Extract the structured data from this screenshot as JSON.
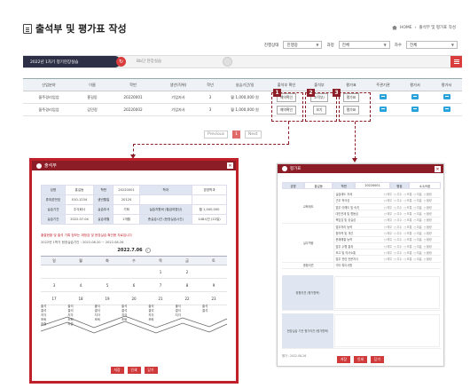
{
  "header": {
    "title": "출석부 및 평가표 작성",
    "breadcrumb": [
      "HOME",
      "출석부 및 평가표 작성"
    ]
  },
  "filters": [
    {
      "label": "진행상태",
      "value": "진행중"
    },
    {
      "label": "과정",
      "value": "전체"
    },
    {
      "label": "차수",
      "value": "전체"
    }
  ],
  "course_bar": {
    "course_name": "2022년 1차기 정기현장실습",
    "placeholder": "Bb단 현장실습"
  },
  "table": {
    "headers": [
      "산업분야",
      "이름",
      "학번",
      "생년(직위)",
      "학년",
      "실습기간/일",
      "출석부 확인",
      "출석부",
      "평가표",
      "주관기관",
      "평가서",
      "평가서"
    ],
    "rows": [
      [
        "울주경리업업",
        "홍길동",
        "20220001",
        "기업자사",
        "3",
        "월 1,000,000 원",
        "예약확인",
        "조작부/",
        "평가표",
        "",
        "",
        ""
      ],
      [
        "울주경리업업",
        "김민정",
        "20220002",
        "기업자사",
        "3",
        "월 1,000,000 원",
        "예약확인",
        "보기",
        "평가표",
        "",
        "",
        ""
      ]
    ]
  },
  "tags": [
    "1",
    "2",
    "3"
  ],
  "pager": {
    "prev": "Previous",
    "current": "1",
    "next": "Next"
  },
  "attendance_panel": {
    "title": "출석부",
    "info": [
      [
        "성명",
        "홍길동",
        "학번",
        "20220001",
        "학과",
        "경영학과"
      ],
      [
        "휴대폰번호",
        "010-1234",
        "생년월일",
        "20120",
        "",
        ""
      ],
      [
        "실습기관",
        "주식회사",
        "실습부서",
        "기획",
        "실습지원비 (월급여환산)",
        "월 1,000,000"
      ],
      [
        "실습기간",
        "2022.07.04",
        "실습개월",
        "1개월",
        "총실습시간 (현장실습시간)",
        "148시간 (22일)"
      ]
    ],
    "note_red": "출결현황 및 출석 기록 정보는 재정검 및 현장실습 확인용 자료입니다",
    "note_gray": "2022년 1학기 현장실습기간 : 2022.06.20 ~ 2022.08.26",
    "month": "2022.7.06",
    "weekdays": [
      "일",
      "월",
      "화",
      "수",
      "목",
      "금",
      "토"
    ],
    "weeks": [
      [
        "",
        "",
        "",
        "",
        "1",
        "2",
        ""
      ],
      [
        "3",
        "4",
        "5",
        "6",
        "7",
        "8",
        "9"
      ]
    ],
    "week3": [
      "17",
      "18",
      "19",
      "20",
      "21",
      "22",
      "23"
    ],
    "entries": [
      {
        "day": "17",
        "lines": [
          "출석",
          "결석",
          "지각",
          "조퇴",
          "외출"
        ]
      },
      {
        "day": "18",
        "lines": [
          "출석",
          "결석",
          "지각",
          "조퇴",
          "외출"
        ]
      },
      {
        "day": "19",
        "lines": [
          "출석",
          "결석",
          "지각",
          "조퇴"
        ]
      },
      {
        "day": "20",
        "lines": [
          "출석",
          "결석",
          "지각",
          "조퇴"
        ]
      },
      {
        "day": "21",
        "lines": [
          "출석",
          "결석",
          "지각",
          "조퇴"
        ]
      },
      {
        "day": "22",
        "lines": [
          "출석",
          "결석",
          "지각"
        ]
      },
      {
        "day": "23",
        "lines": [
          "출석",
          "결석"
        ]
      }
    ],
    "buttons": [
      "저장",
      "인쇄",
      "닫기"
    ]
  },
  "eval_panel": {
    "title": "평가표",
    "top": [
      "성명",
      "홍길동",
      "학번",
      "20220001",
      "평점",
      "4.5/5점"
    ],
    "categories": [
      "교육태도",
      "실무역량",
      "종합의견"
    ],
    "rows": [
      "실습태도 자세",
      "근무 적극성",
      "업무 이해도 및 숙지",
      "대인관계 및 협동심",
      "책임감 및 성실성",
      "업무처리 능력",
      "창의력 및 개선",
      "문제해결 능력",
      "업무 수행 결과",
      "보고 및 의사소통",
      "업무 관련 전문지식",
      "기타 특이사항"
    ],
    "radio_labels": [
      "매우",
      "우수",
      "보통",
      "미흡",
      "불량"
    ],
    "textareas": [
      "종합의견 (평가항목)",
      "현장실습 기관 평가의견 (평가항목)"
    ],
    "date_note": "평가 : 2022.08.26",
    "buttons": [
      "저장",
      "인쇄",
      "닫기"
    ]
  },
  "colors": {
    "accent": "#8c1d27",
    "highlight_frame": "#c0202a",
    "dark_bar": "#2c2f45",
    "icon_blue": "#29a3d9"
  }
}
